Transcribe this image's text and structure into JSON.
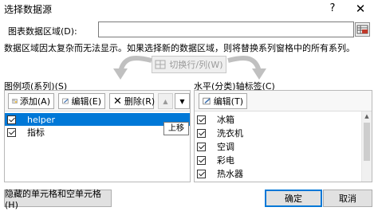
{
  "window": {
    "title": "选择数据源",
    "help": "?",
    "close": "✕"
  },
  "range": {
    "label": "图表数据区域(D):",
    "value": ""
  },
  "warning": "数据区域因太复杂而无法显示。如果选择新的数据区域，则将替换系列窗格中的所有系列。",
  "swap_button": "切换行/列(W)",
  "legend": {
    "label": "图例项(系列)(S)",
    "add": "添加(A)",
    "edit": "编辑(E)",
    "delete": "删除(R)",
    "move_up": "▲",
    "move_down": "▼",
    "items": [
      {
        "label": "helper",
        "checked": true,
        "selected": true
      },
      {
        "label": "指标",
        "checked": true,
        "selected": false
      }
    ],
    "tooltip": "上移"
  },
  "axis": {
    "label": "水平(分类)轴标签(C)",
    "edit": "编辑(T)",
    "items": [
      {
        "label": "冰箱",
        "checked": true
      },
      {
        "label": "洗衣机",
        "checked": true
      },
      {
        "label": "空调",
        "checked": true
      },
      {
        "label": "彩电",
        "checked": true
      },
      {
        "label": "热水器",
        "checked": true
      }
    ]
  },
  "footer": {
    "hidden_cells": "隐藏的单元格和空单元格(H)",
    "ok": "确定",
    "cancel": "取消"
  },
  "colors": {
    "selection": "#0078d7",
    "dialog_bg": "#ffffff"
  }
}
